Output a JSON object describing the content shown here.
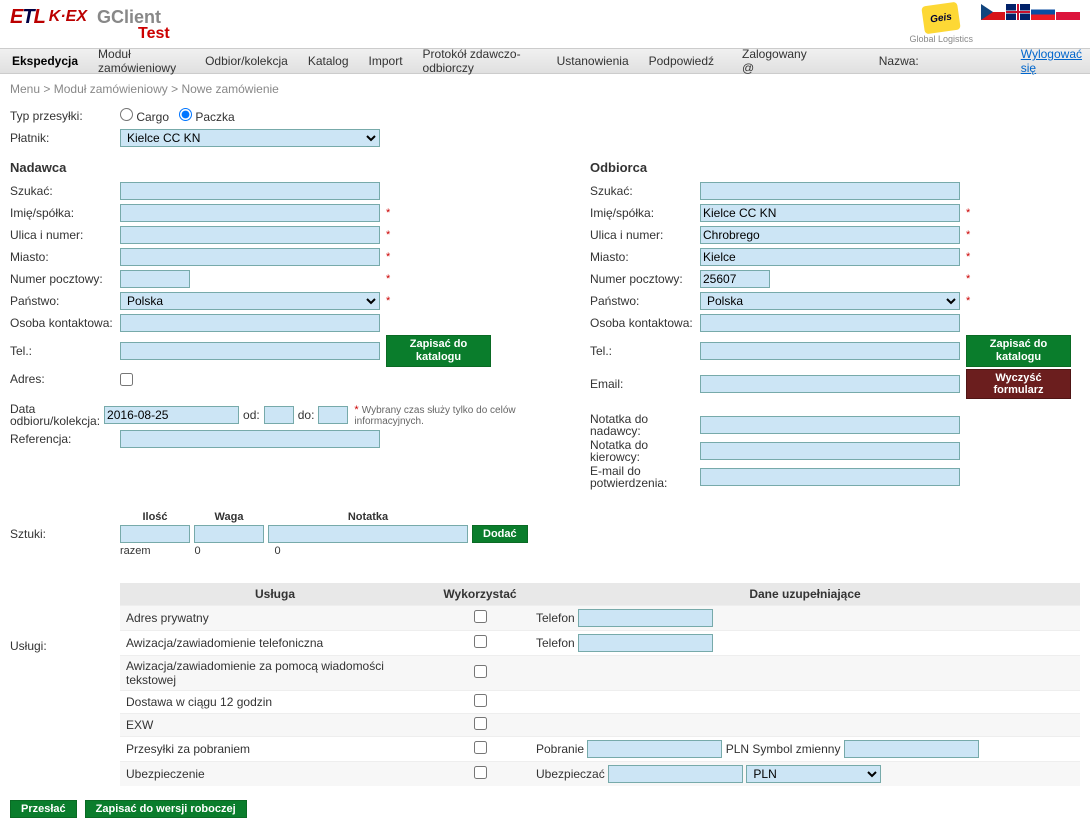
{
  "header": {
    "app_title": "GClient",
    "app_sub": "Test",
    "geis_label": "Geis",
    "geis_sub": "Global Logistics"
  },
  "nav": {
    "items": [
      "Ekspedycja",
      "Moduł zamówieniowy",
      "Odbior/kolekcja",
      "Katalog",
      "Import",
      "Protokół zdawczo-odbiorczy",
      "Ustanowienia",
      "Podpowiedź"
    ],
    "logged_label": "Zalogowany @",
    "name_label": "Nazwa:",
    "logout": "Wylogować się"
  },
  "breadcrumb": {
    "a": "Menu",
    "b": "Moduł zamówieniowy",
    "c": "Nowe zamówienie"
  },
  "top": {
    "type_label": "Typ przesyłki:",
    "radio_cargo": "Cargo",
    "radio_paczka": "Paczka",
    "payer_label": "Płatnik:",
    "payer_value": "Kielce CC KN"
  },
  "sender": {
    "title": "Nadawca",
    "search": "Szukać:",
    "name": "Imię/spółka:",
    "street": "Ulica i numer:",
    "city": "Miasto:",
    "zip": "Numer pocztowy:",
    "country": "Państwo:",
    "country_value": "Polska",
    "contact": "Osoba kontaktowa:",
    "tel": "Tel.:",
    "addr": "Adres:",
    "save_btn": "Zapisać do katalogu"
  },
  "recipient": {
    "title": "Odbiorca",
    "search": "Szukać:",
    "name": "Imię/spółka:",
    "name_v": "Kielce CC KN",
    "street": "Ulica i numer:",
    "street_v": "Chrobrego",
    "city": "Miasto:",
    "city_v": "Kielce",
    "zip": "Numer pocztowy:",
    "zip_v": "25607",
    "country": "Państwo:",
    "country_v": "Polska",
    "contact": "Osoba kontaktowa:",
    "tel": "Tel.:",
    "email": "Email:",
    "save_btn": "Zapisać do katalogu",
    "clear_btn": "Wyczyść formularz",
    "note_sender": "Notatka do nadawcy:",
    "note_driver": "Notatka do kierowcy:",
    "confirm_email": "E-mail do potwierdzenia:"
  },
  "pickup": {
    "date_label": "Data odbioru/kolekcja:",
    "date_v": "2016-08-25",
    "from": "od:",
    "to": "do:",
    "note": "Wybrany czas służy tylko do celów informacyjnych.",
    "ref": "Referencja:"
  },
  "pieces": {
    "label": "Sztuki:",
    "qty": "Ilość",
    "weight": "Waga",
    "note": "Notatka",
    "add": "Dodać",
    "total_label": "razem",
    "total_qty": "0",
    "total_weight": "0"
  },
  "services": {
    "label": "Usługi:",
    "hdr_service": "Usługa",
    "hdr_use": "Wykorzystać",
    "hdr_extra": "Dane uzupełniające",
    "rows": [
      {
        "name": "Adres prywatny",
        "extra_label": "Telefon"
      },
      {
        "name": "Awizacja/zawiadomienie telefoniczna",
        "extra_label": "Telefon"
      },
      {
        "name": "Awizacja/zawiadomienie za pomocą wiadomości tekstowej"
      },
      {
        "name": "Dostawa w ciągu 12 godzin"
      },
      {
        "name": "EXW"
      },
      {
        "name": "Przesyłki za pobraniem",
        "extra_label": "Pobranie",
        "extra_label2": "PLN Symbol zmienny"
      },
      {
        "name": "Ubezpieczenie",
        "extra_label": "Ubezpieczać",
        "extra_select": "PLN"
      }
    ]
  },
  "buttons": {
    "send": "Przesłać",
    "draft": "Zapisać do wersji roboczej"
  }
}
